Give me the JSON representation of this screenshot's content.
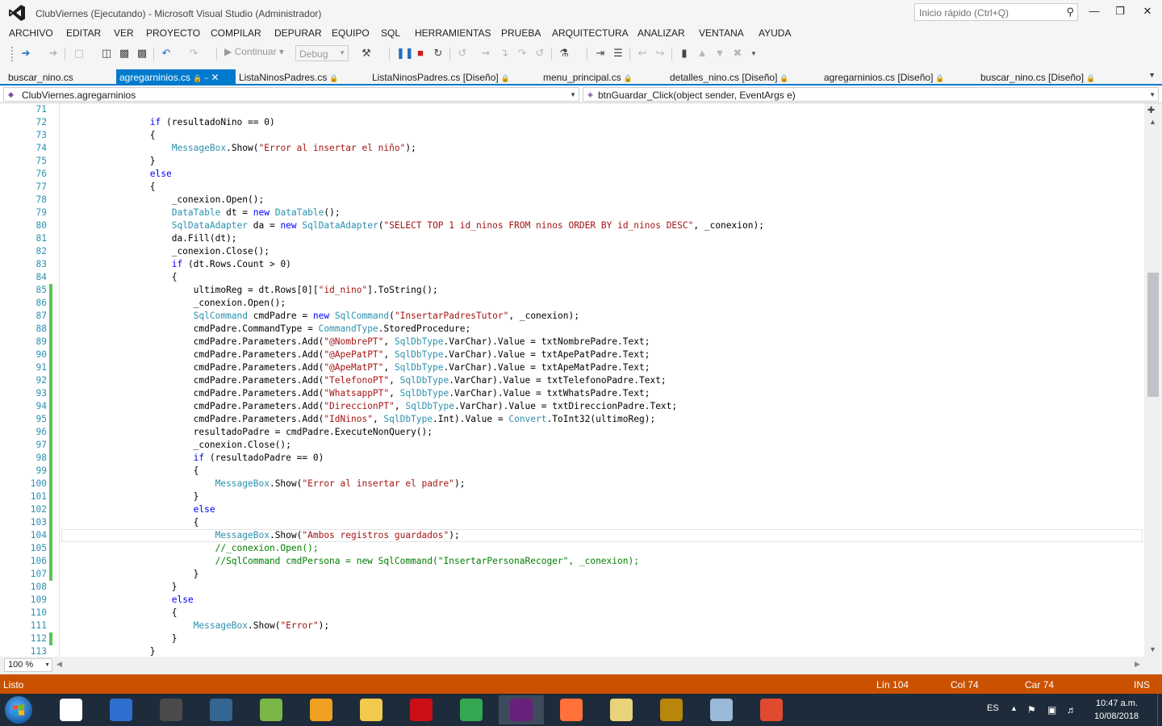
{
  "window": {
    "title": "ClubViernes (Ejecutando) - Microsoft Visual Studio (Administrador)",
    "quick_launch_placeholder": "Inicio rápido (Ctrl+Q)"
  },
  "menu": [
    "ARCHIVO",
    "EDITAR",
    "VER",
    "PROYECTO",
    "COMPILAR",
    "DEPURAR",
    "EQUIPO",
    "SQL",
    "HERRAMIENTAS",
    "PRUEBA",
    "ARQUITECTURA",
    "ANALIZAR",
    "VENTANA",
    "AYUDA"
  ],
  "toolbar": {
    "continue_label": "Continuar",
    "config_value": "Debug"
  },
  "tabs": [
    {
      "label": "buscar_nino.cs",
      "active": false
    },
    {
      "label": "agregarninios.cs",
      "active": true
    },
    {
      "label": "ListaNinosPadres.cs",
      "active": false
    },
    {
      "label": "ListaNinosPadres.cs [Diseño]",
      "active": false
    },
    {
      "label": "menu_principal.cs",
      "active": false
    },
    {
      "label": "detalles_nino.cs [Diseño]",
      "active": false
    },
    {
      "label": "agregarninios.cs [Diseño]",
      "active": false
    },
    {
      "label": "buscar_nino.cs [Diseño]",
      "active": false
    }
  ],
  "nav": {
    "class_name": "ClubViernes.agregarninios",
    "member_name": "btnGuardar_Click(object sender, EventArgs e)"
  },
  "editor": {
    "current_line": 104,
    "lines": [
      {
        "n": "71",
        "mod": false,
        "segs": []
      },
      {
        "n": "72",
        "mod": false,
        "segs": [
          [
            "p",
            "                "
          ],
          [
            "k",
            "if"
          ],
          [
            "p",
            " (resultadoNino == 0)"
          ]
        ]
      },
      {
        "n": "73",
        "mod": false,
        "segs": [
          [
            "p",
            "                {"
          ]
        ]
      },
      {
        "n": "74",
        "mod": false,
        "segs": [
          [
            "p",
            "                    "
          ],
          [
            "t",
            "MessageBox"
          ],
          [
            "p",
            ".Show("
          ],
          [
            "s",
            "\"Error al insertar el niño\""
          ],
          [
            "p",
            ");"
          ]
        ]
      },
      {
        "n": "75",
        "mod": false,
        "segs": [
          [
            "p",
            "                }"
          ]
        ]
      },
      {
        "n": "76",
        "mod": false,
        "segs": [
          [
            "p",
            "                "
          ],
          [
            "k",
            "else"
          ]
        ]
      },
      {
        "n": "77",
        "mod": false,
        "segs": [
          [
            "p",
            "                {"
          ]
        ]
      },
      {
        "n": "78",
        "mod": false,
        "segs": [
          [
            "p",
            "                    _conexion.Open();"
          ]
        ]
      },
      {
        "n": "79",
        "mod": false,
        "segs": [
          [
            "p",
            "                    "
          ],
          [
            "t",
            "DataTable"
          ],
          [
            "p",
            " dt = "
          ],
          [
            "k",
            "new"
          ],
          [
            "p",
            " "
          ],
          [
            "t",
            "DataTable"
          ],
          [
            "p",
            "();"
          ]
        ]
      },
      {
        "n": "80",
        "mod": false,
        "segs": [
          [
            "p",
            "                    "
          ],
          [
            "t",
            "SqlDataAdapter"
          ],
          [
            "p",
            " da = "
          ],
          [
            "k",
            "new"
          ],
          [
            "p",
            " "
          ],
          [
            "t",
            "SqlDataAdapter"
          ],
          [
            "p",
            "("
          ],
          [
            "s",
            "\"SELECT TOP 1 id_ninos FROM ninos ORDER BY id_ninos DESC\""
          ],
          [
            "p",
            ", _conexion);"
          ]
        ]
      },
      {
        "n": "81",
        "mod": false,
        "segs": [
          [
            "p",
            "                    da.Fill(dt);"
          ]
        ]
      },
      {
        "n": "82",
        "mod": false,
        "segs": [
          [
            "p",
            "                    _conexion.Close();"
          ]
        ]
      },
      {
        "n": "83",
        "mod": false,
        "segs": [
          [
            "p",
            "                    "
          ],
          [
            "k",
            "if"
          ],
          [
            "p",
            " (dt.Rows.Count > 0)"
          ]
        ]
      },
      {
        "n": "84",
        "mod": false,
        "segs": [
          [
            "p",
            "                    {"
          ]
        ]
      },
      {
        "n": "85",
        "mod": true,
        "segs": [
          [
            "p",
            "                        ultimoReg = dt.Rows[0]["
          ],
          [
            "s",
            "\"id_nino\""
          ],
          [
            "p",
            "].ToString();"
          ]
        ]
      },
      {
        "n": "86",
        "mod": true,
        "segs": [
          [
            "p",
            "                        _conexion.Open();"
          ]
        ]
      },
      {
        "n": "87",
        "mod": true,
        "segs": [
          [
            "p",
            "                        "
          ],
          [
            "t",
            "SqlCommand"
          ],
          [
            "p",
            " cmdPadre = "
          ],
          [
            "k",
            "new"
          ],
          [
            "p",
            " "
          ],
          [
            "t",
            "SqlCommand"
          ],
          [
            "p",
            "("
          ],
          [
            "s",
            "\"InsertarPadresTutor\""
          ],
          [
            "p",
            ", _conexion);"
          ]
        ]
      },
      {
        "n": "88",
        "mod": true,
        "segs": [
          [
            "p",
            "                        cmdPadre.CommandType = "
          ],
          [
            "t",
            "CommandType"
          ],
          [
            "p",
            ".StoredProcedure;"
          ]
        ]
      },
      {
        "n": "89",
        "mod": true,
        "segs": [
          [
            "p",
            "                        cmdPadre.Parameters.Add("
          ],
          [
            "s",
            "\"@NombrePT\""
          ],
          [
            "p",
            ", "
          ],
          [
            "t",
            "SqlDbType"
          ],
          [
            "p",
            ".VarChar).Value = txtNombrePadre.Text;"
          ]
        ]
      },
      {
        "n": "90",
        "mod": true,
        "segs": [
          [
            "p",
            "                        cmdPadre.Parameters.Add("
          ],
          [
            "s",
            "\"@ApePatPT\""
          ],
          [
            "p",
            ", "
          ],
          [
            "t",
            "SqlDbType"
          ],
          [
            "p",
            ".VarChar).Value = txtApePatPadre.Text;"
          ]
        ]
      },
      {
        "n": "91",
        "mod": true,
        "segs": [
          [
            "p",
            "                        cmdPadre.Parameters.Add("
          ],
          [
            "s",
            "\"@ApeMatPT\""
          ],
          [
            "p",
            ", "
          ],
          [
            "t",
            "SqlDbType"
          ],
          [
            "p",
            ".VarChar).Value = txtApeMatPadre.Text;"
          ]
        ]
      },
      {
        "n": "92",
        "mod": true,
        "segs": [
          [
            "p",
            "                        cmdPadre.Parameters.Add("
          ],
          [
            "s",
            "\"TelefonoPT\""
          ],
          [
            "p",
            ", "
          ],
          [
            "t",
            "SqlDbType"
          ],
          [
            "p",
            ".VarChar).Value = txtTelefonoPadre.Text;"
          ]
        ]
      },
      {
        "n": "93",
        "mod": true,
        "segs": [
          [
            "p",
            "                        cmdPadre.Parameters.Add("
          ],
          [
            "s",
            "\"WhatsappPT\""
          ],
          [
            "p",
            ", "
          ],
          [
            "t",
            "SqlDbType"
          ],
          [
            "p",
            ".VarChar).Value = txtWhatsPadre.Text;"
          ]
        ]
      },
      {
        "n": "94",
        "mod": true,
        "segs": [
          [
            "p",
            "                        cmdPadre.Parameters.Add("
          ],
          [
            "s",
            "\"DireccionPT\""
          ],
          [
            "p",
            ", "
          ],
          [
            "t",
            "SqlDbType"
          ],
          [
            "p",
            ".VarChar).Value = txtDireccionPadre.Text;"
          ]
        ]
      },
      {
        "n": "95",
        "mod": true,
        "segs": [
          [
            "p",
            "                        cmdPadre.Parameters.Add("
          ],
          [
            "s",
            "\"IdNinos\""
          ],
          [
            "p",
            ", "
          ],
          [
            "t",
            "SqlDbType"
          ],
          [
            "p",
            ".Int).Value = "
          ],
          [
            "t",
            "Convert"
          ],
          [
            "p",
            ".ToInt32(ultimoReg);"
          ]
        ]
      },
      {
        "n": "96",
        "mod": true,
        "segs": [
          [
            "p",
            "                        resultadoPadre = cmdPadre.ExecuteNonQuery();"
          ]
        ]
      },
      {
        "n": "97",
        "mod": true,
        "segs": [
          [
            "p",
            "                        _conexion.Close();"
          ]
        ]
      },
      {
        "n": "98",
        "mod": true,
        "segs": [
          [
            "p",
            "                        "
          ],
          [
            "k",
            "if"
          ],
          [
            "p",
            " (resultadoPadre == 0)"
          ]
        ]
      },
      {
        "n": "99",
        "mod": true,
        "segs": [
          [
            "p",
            "                        {"
          ]
        ]
      },
      {
        "n": "100",
        "mod": true,
        "segs": [
          [
            "p",
            "                            "
          ],
          [
            "t",
            "MessageBox"
          ],
          [
            "p",
            ".Show("
          ],
          [
            "s",
            "\"Error al insertar el padre\""
          ],
          [
            "p",
            ");"
          ]
        ]
      },
      {
        "n": "101",
        "mod": true,
        "segs": [
          [
            "p",
            "                        }"
          ]
        ]
      },
      {
        "n": "102",
        "mod": true,
        "segs": [
          [
            "p",
            "                        "
          ],
          [
            "k",
            "else"
          ]
        ]
      },
      {
        "n": "103",
        "mod": true,
        "segs": [
          [
            "p",
            "                        {"
          ]
        ]
      },
      {
        "n": "104",
        "mod": true,
        "segs": [
          [
            "p",
            "                            "
          ],
          [
            "t",
            "MessageBox"
          ],
          [
            "p",
            ".Show("
          ],
          [
            "s",
            "\"Ambos registros guardados\""
          ],
          [
            "p",
            ");"
          ]
        ]
      },
      {
        "n": "105",
        "mod": true,
        "segs": [
          [
            "p",
            "                            "
          ],
          [
            "c",
            "//_conexion.Open();"
          ]
        ]
      },
      {
        "n": "106",
        "mod": true,
        "segs": [
          [
            "p",
            "                            "
          ],
          [
            "c",
            "//SqlCommand cmdPersona = new SqlCommand(\"InsertarPersonaRecoger\", _conexion);"
          ]
        ]
      },
      {
        "n": "107",
        "mod": true,
        "segs": [
          [
            "p",
            "                        }"
          ]
        ]
      },
      {
        "n": "108",
        "mod": false,
        "segs": [
          [
            "p",
            "                    }"
          ]
        ]
      },
      {
        "n": "109",
        "mod": false,
        "segs": [
          [
            "p",
            "                    "
          ],
          [
            "k",
            "else"
          ]
        ]
      },
      {
        "n": "110",
        "mod": false,
        "segs": [
          [
            "p",
            "                    {"
          ]
        ]
      },
      {
        "n": "111",
        "mod": false,
        "segs": [
          [
            "p",
            "                        "
          ],
          [
            "t",
            "MessageBox"
          ],
          [
            "p",
            ".Show("
          ],
          [
            "s",
            "\"Error\""
          ],
          [
            "p",
            ");"
          ]
        ]
      },
      {
        "n": "112",
        "mod": true,
        "segs": [
          [
            "p",
            "                    }"
          ]
        ]
      },
      {
        "n": "113",
        "mod": false,
        "segs": [
          [
            "p",
            "                }"
          ]
        ]
      }
    ]
  },
  "zoom": "100 %",
  "status": {
    "state": "Listo",
    "line": "Lín 104",
    "col": "Col 74",
    "char": "Car 74",
    "mode": "INS"
  },
  "taskbar": {
    "lang": "ES",
    "time": "10:47 a.m.",
    "date": "10/08/2018",
    "apps": [
      {
        "name": "vnc-viewer-icon",
        "color": "#ffffff",
        "active": false
      },
      {
        "name": "network-tool-icon",
        "color": "#2f6fd0",
        "active": false
      },
      {
        "name": "eye-app-icon",
        "color": "#4a4a4a",
        "active": false
      },
      {
        "name": "postgresql-icon",
        "color": "#336791",
        "active": false
      },
      {
        "name": "spreadsheet-app-icon",
        "color": "#7ab648",
        "active": false
      },
      {
        "name": "caja-app-icon",
        "color": "#f0a020",
        "active": false
      },
      {
        "name": "file-explorer-icon",
        "color": "#f2c94c",
        "active": false
      },
      {
        "name": "opera-icon",
        "color": "#cc0f16",
        "active": false
      },
      {
        "name": "chrome-icon",
        "color": "#34a853",
        "active": false
      },
      {
        "name": "visual-studio-icon",
        "color": "#68217a",
        "active": true
      },
      {
        "name": "firefox-icon",
        "color": "#ff7139",
        "active": false
      },
      {
        "name": "folder-app-icon",
        "color": "#e8d37a",
        "active": false
      },
      {
        "name": "tools-app-icon",
        "color": "#b8860b",
        "active": false
      },
      {
        "name": "paint-app-icon",
        "color": "#9ab8d8",
        "active": false
      },
      {
        "name": "window-app-icon",
        "color": "#e04a2f",
        "active": false
      }
    ]
  },
  "colors": {
    "accent": "#007acc",
    "status_bar": "#ca5100",
    "keyword": "#0000ff",
    "type": "#2b91af",
    "string": "#a31515",
    "comment": "#008000",
    "changed_line": "#57c754"
  }
}
